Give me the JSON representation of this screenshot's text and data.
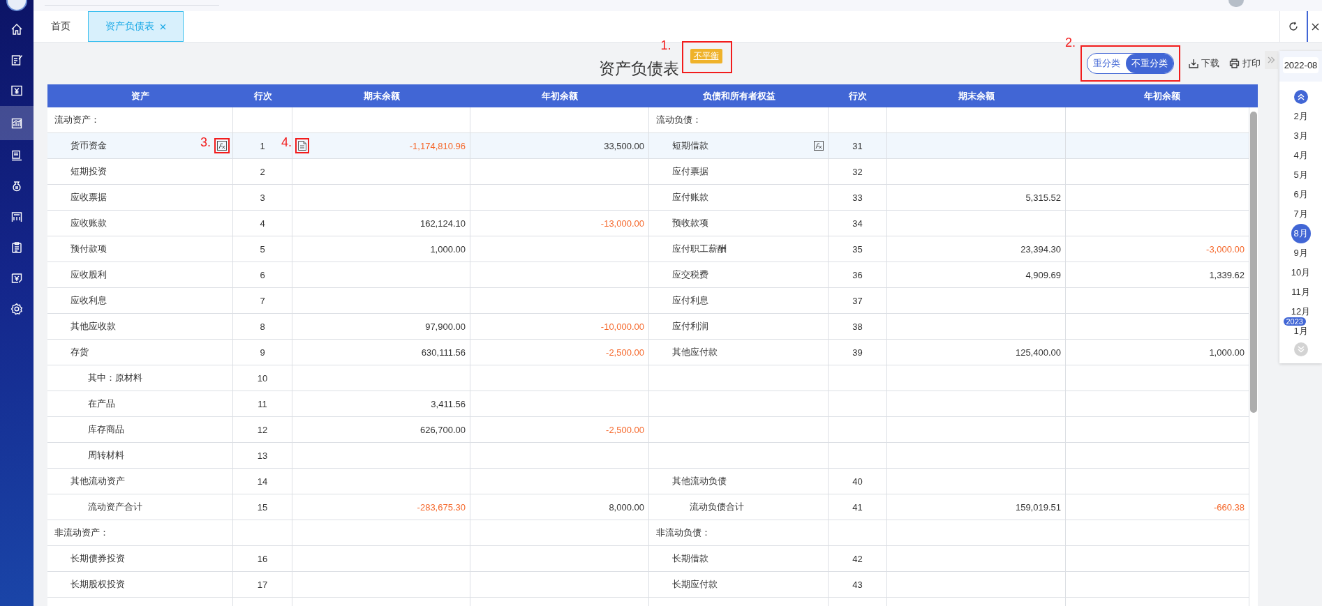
{
  "sidebar": {
    "items": [
      {
        "selected": false
      },
      {
        "selected": false
      },
      {
        "selected": false
      },
      {
        "selected": true
      },
      {
        "selected": false
      },
      {
        "selected": false
      },
      {
        "selected": false
      },
      {
        "selected": false
      },
      {
        "selected": false
      },
      {
        "selected": false
      }
    ]
  },
  "tabs": [
    {
      "label": "首页",
      "selected": false,
      "closable": false
    },
    {
      "label": "资产负债表",
      "selected": true,
      "closable": true
    }
  ],
  "report": {
    "title": "资产负债表",
    "status_badge": {
      "text": "不平衡",
      "annotation": "1."
    },
    "reclass_toggle": {
      "annotation": "2.",
      "options": [
        {
          "label": "重分类",
          "selected": false
        },
        {
          "label": "不重分类",
          "selected": true
        }
      ]
    },
    "actions": [
      {
        "kind": "download",
        "label": "下载"
      },
      {
        "kind": "print",
        "label": "打印"
      }
    ]
  },
  "table": {
    "columns": [
      "资产",
      "行次",
      "期末余额",
      "年初余额",
      "负债和所有者权益",
      "行次",
      "期末余额",
      "年初余额"
    ],
    "rows": [
      {
        "selected": false,
        "left": {
          "kind": "section",
          "name": "流动资产："
        },
        "right": {
          "kind": "section",
          "name": "流动负债："
        }
      },
      {
        "selected": true,
        "left": {
          "kind": "item",
          "name": "货币资金",
          "line": "1",
          "end": {
            "text": "-1,174,810.96",
            "negative": true
          },
          "begin": {
            "text": "33,500.00",
            "negative": false
          },
          "formula_icon": true,
          "formula_annotation": "3.",
          "detail_icon": true,
          "detail_annotation": "4."
        },
        "right": {
          "kind": "item",
          "name": "短期借款",
          "line": "31",
          "formula_icon": true
        }
      },
      {
        "selected": false,
        "left": {
          "kind": "item",
          "name": "短期投资",
          "line": "2"
        },
        "right": {
          "kind": "item",
          "name": "应付票据",
          "line": "32"
        }
      },
      {
        "selected": false,
        "left": {
          "kind": "item",
          "name": "应收票据",
          "line": "3"
        },
        "right": {
          "kind": "item",
          "name": "应付账款",
          "line": "33",
          "end": {
            "text": "5,315.52",
            "negative": false
          }
        }
      },
      {
        "selected": false,
        "left": {
          "kind": "item",
          "name": "应收账款",
          "line": "4",
          "end": {
            "text": "162,124.10",
            "negative": false
          },
          "begin": {
            "text": "-13,000.00",
            "negative": true
          }
        },
        "right": {
          "kind": "item",
          "name": "预收款项",
          "line": "34"
        }
      },
      {
        "selected": false,
        "left": {
          "kind": "item",
          "name": "预付款项",
          "line": "5",
          "end": {
            "text": "1,000.00",
            "negative": false
          }
        },
        "right": {
          "kind": "item",
          "name": "应付职工薪酬",
          "line": "35",
          "end": {
            "text": "23,394.30",
            "negative": false
          },
          "begin": {
            "text": "-3,000.00",
            "negative": true
          }
        }
      },
      {
        "selected": false,
        "left": {
          "kind": "item",
          "name": "应收股利",
          "line": "6"
        },
        "right": {
          "kind": "item",
          "name": "应交税费",
          "line": "36",
          "end": {
            "text": "4,909.69",
            "negative": false
          },
          "begin": {
            "text": "1,339.62",
            "negative": false
          }
        }
      },
      {
        "selected": false,
        "left": {
          "kind": "item",
          "name": "应收利息",
          "line": "7"
        },
        "right": {
          "kind": "item",
          "name": "应付利息",
          "line": "37"
        }
      },
      {
        "selected": false,
        "left": {
          "kind": "item",
          "name": "其他应收款",
          "line": "8",
          "end": {
            "text": "97,900.00",
            "negative": false
          },
          "begin": {
            "text": "-10,000.00",
            "negative": true
          }
        },
        "right": {
          "kind": "item",
          "name": "应付利润",
          "line": "38"
        }
      },
      {
        "selected": false,
        "left": {
          "kind": "item",
          "name": "存货",
          "line": "9",
          "end": {
            "text": "630,111.56",
            "negative": false
          },
          "begin": {
            "text": "-2,500.00",
            "negative": true
          }
        },
        "right": {
          "kind": "item",
          "name": "其他应付款",
          "line": "39",
          "end": {
            "text": "125,400.00",
            "negative": false
          },
          "begin": {
            "text": "1,000.00",
            "negative": false
          }
        }
      },
      {
        "selected": false,
        "left": {
          "kind": "sub",
          "name": "其中：原材料",
          "line": "10"
        }
      },
      {
        "selected": false,
        "left": {
          "kind": "sub",
          "name": "在产品",
          "line": "11",
          "end": {
            "text": "3,411.56",
            "negative": false
          }
        }
      },
      {
        "selected": false,
        "left": {
          "kind": "sub",
          "name": "库存商品",
          "line": "12",
          "end": {
            "text": "626,700.00",
            "negative": false
          },
          "begin": {
            "text": "-2,500.00",
            "negative": true
          }
        }
      },
      {
        "selected": false,
        "left": {
          "kind": "sub",
          "name": "周转材料",
          "line": "13"
        }
      },
      {
        "selected": false,
        "left": {
          "kind": "item",
          "name": "其他流动资产",
          "line": "14"
        },
        "right": {
          "kind": "item",
          "name": "其他流动负债",
          "line": "40"
        }
      },
      {
        "selected": false,
        "left": {
          "kind": "sub",
          "name": "流动资产合计",
          "line": "15",
          "end": {
            "text": "-283,675.30",
            "negative": true
          },
          "begin": {
            "text": "8,000.00",
            "negative": false
          }
        },
        "right": {
          "kind": "sub",
          "name": "流动负债合计",
          "line": "41",
          "end": {
            "text": "159,019.51",
            "negative": false
          },
          "begin": {
            "text": "-660.38",
            "negative": true
          }
        }
      },
      {
        "selected": false,
        "left": {
          "kind": "section",
          "name": "非流动资产："
        },
        "right": {
          "kind": "section",
          "name": "非流动负债："
        }
      },
      {
        "selected": false,
        "left": {
          "kind": "item",
          "name": "长期债券投资",
          "line": "16"
        },
        "right": {
          "kind": "item",
          "name": "长期借款",
          "line": "42"
        }
      },
      {
        "selected": false,
        "left": {
          "kind": "item",
          "name": "长期股权投资",
          "line": "17"
        },
        "right": {
          "kind": "item",
          "name": "长期应付款",
          "line": "43"
        }
      }
    ]
  },
  "period_panel": {
    "current": "2022-08",
    "months": [
      {
        "label": "2月",
        "selected": false
      },
      {
        "label": "3月",
        "selected": false
      },
      {
        "label": "4月",
        "selected": false
      },
      {
        "label": "5月",
        "selected": false
      },
      {
        "label": "6月",
        "selected": false
      },
      {
        "label": "7月",
        "selected": false
      },
      {
        "label": "8月",
        "selected": true
      },
      {
        "label": "9月",
        "selected": false
      },
      {
        "label": "10月",
        "selected": false
      },
      {
        "label": "11月",
        "selected": false
      },
      {
        "label": "12月",
        "selected": false
      },
      {
        "label": "1月",
        "selected": false,
        "year_badge": "2023"
      }
    ]
  }
}
